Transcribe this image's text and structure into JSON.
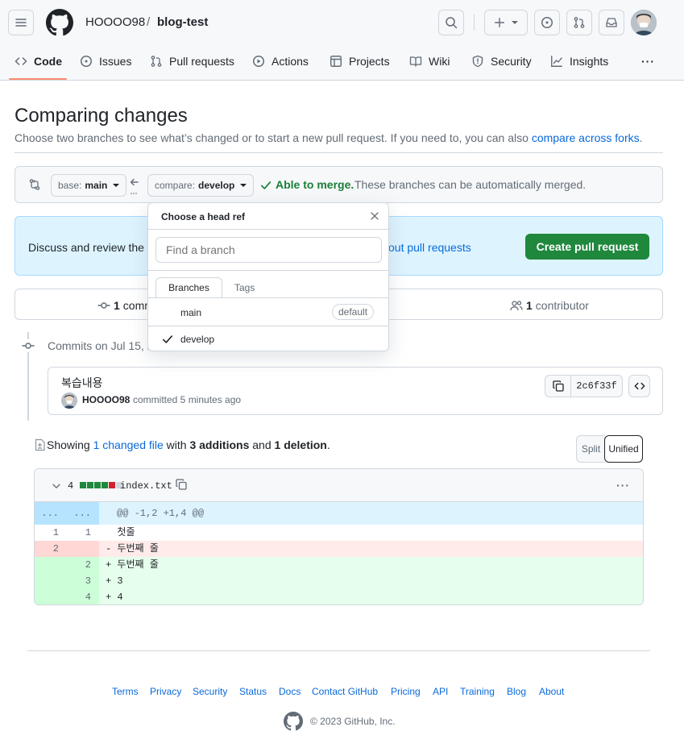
{
  "header": {
    "owner": "HOOOO98",
    "separator": "/",
    "repo": "blog-test",
    "tabs": [
      {
        "label": "Code",
        "icon": "code-icon"
      },
      {
        "label": "Issues",
        "icon": "issue-icon"
      },
      {
        "label": "Pull requests",
        "icon": "pull-request-icon"
      },
      {
        "label": "Actions",
        "icon": "play-icon"
      },
      {
        "label": "Projects",
        "icon": "table-icon"
      },
      {
        "label": "Wiki",
        "icon": "book-icon"
      },
      {
        "label": "Security",
        "icon": "shield-icon"
      },
      {
        "label": "Insights",
        "icon": "graph-icon"
      }
    ],
    "more": "···"
  },
  "page": {
    "title": "Comparing changes",
    "subtitle": "Choose two branches to see what’s changed or to start a new pull request. If you need to, you can also ",
    "subtitle_link": "compare across forks",
    "subtitle_end": "."
  },
  "range": {
    "base_prefix": "base:",
    "base_branch": "main",
    "compare_prefix": "compare:",
    "compare_branch": "develop",
    "merge_status": "Able to merge.",
    "merge_detail": "These branches can be automatically merged."
  },
  "discuss": {
    "text_start": "Discuss and review the c",
    "text_link": "out pull requests",
    "create_button": "Create pull request"
  },
  "stats": {
    "commits_count": "1",
    "commits_label": "comm",
    "contributors_count": "1",
    "contributors_label": "contributor"
  },
  "commits": {
    "date_header": "Commits on Jul 15, 2",
    "message": "복습내용",
    "author": "HOOOO98",
    "action": "committed 5 minutes ago",
    "sha": "2c6f33f"
  },
  "summary": {
    "prefix": "Showing ",
    "changed_files": "1 changed file",
    "with": " with ",
    "additions": "3 additions",
    "and": " and ",
    "deletions": "1 deletion",
    "end": ".",
    "split_label": "Split",
    "unified_label": "Unified"
  },
  "diff": {
    "change_count": "4",
    "filename": "index.txt",
    "hunk_left": "...",
    "hunk_right": "...",
    "hunk_header": "@@ -1,2 +1,4 @@",
    "lines": [
      {
        "old": "1",
        "new": "1",
        "type": "context",
        "text": "  첫줄"
      },
      {
        "old": "2",
        "new": "",
        "type": "del",
        "text": "- 두번째 줄"
      },
      {
        "old": "",
        "new": "2",
        "type": "add",
        "text": "+ 두번째 줄"
      },
      {
        "old": "",
        "new": "3",
        "type": "add",
        "text": "+ 3"
      },
      {
        "old": "",
        "new": "4",
        "type": "add",
        "text": "+ 4"
      }
    ],
    "stat_blocks": [
      "add",
      "add",
      "add",
      "add",
      "del"
    ]
  },
  "dropdown": {
    "title": "Choose a head ref",
    "placeholder": "Find a branch",
    "tab_branches": "Branches",
    "tab_tags": "Tags",
    "items": [
      {
        "name": "main",
        "badge": "default",
        "selected": false
      },
      {
        "name": "develop",
        "badge": "",
        "selected": true
      }
    ]
  },
  "footer": {
    "links": [
      "Terms",
      "Privacy",
      "Security",
      "Status",
      "Docs",
      "Contact GitHub",
      "Pricing",
      "API",
      "Training",
      "Blog",
      "About"
    ],
    "copyright": "© 2023 GitHub, Inc."
  },
  "colors": {
    "accent": "#0969da",
    "success": "#1f883d",
    "danger": "#cf222e",
    "add_bg": "#e6ffec",
    "add_num_bg": "#ccffd8",
    "del_bg": "#ffebe9",
    "del_num_bg": "#ffd7d5",
    "hunk_bg": "#ddf4ff"
  }
}
